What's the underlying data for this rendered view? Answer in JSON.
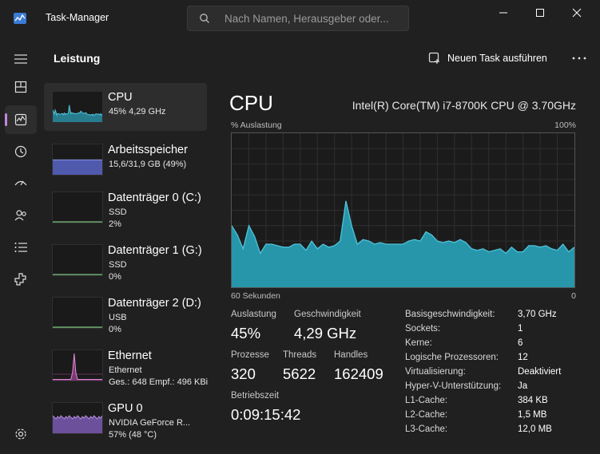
{
  "app": {
    "title": "Task-Manager"
  },
  "search": {
    "placeholder": "Nach Namen, Herausgeber oder..."
  },
  "header": {
    "title": "Leistung",
    "new_task_label": "Neuen Task ausführen"
  },
  "nav": [
    {
      "name": "menu-icon"
    },
    {
      "name": "processes-icon"
    },
    {
      "name": "performance-icon",
      "active": true
    },
    {
      "name": "history-icon"
    },
    {
      "name": "startup-icon"
    },
    {
      "name": "users-icon"
    },
    {
      "name": "details-icon"
    },
    {
      "name": "services-icon"
    },
    {
      "name": "settings-icon"
    }
  ],
  "perf_list": [
    {
      "key": "cpu",
      "name": "CPU",
      "line1": "45%  4,29 GHz",
      "line2": "",
      "line3": "",
      "color": "#4fc3d9",
      "fill": "#2a8ea3",
      "active": true
    },
    {
      "key": "mem",
      "name": "Arbeitsspeicher",
      "line1": "15,6/31,9 GB (49%)",
      "line2": "",
      "line3": "",
      "color": "#8c95e8",
      "fill": "#5a66c8"
    },
    {
      "key": "disk0",
      "name": "Datenträger 0 (C:)",
      "line1": "SSD",
      "line2": "2%",
      "line3": "",
      "color": "#8fd18f",
      "fill": "#3b6b3b"
    },
    {
      "key": "disk1",
      "name": "Datenträger 1 (G:)",
      "line1": "SSD",
      "line2": "0%",
      "line3": "",
      "color": "#8fd18f",
      "fill": "#3b6b3b"
    },
    {
      "key": "disk2",
      "name": "Datenträger 2 (D:)",
      "line1": "USB",
      "line2": "0%",
      "line3": "",
      "color": "#8fd18f",
      "fill": "#3b6b3b"
    },
    {
      "key": "eth",
      "name": "Ethernet",
      "line1": "Ethernet",
      "line2": "Ges.: 648 Empf.: 496 KBi",
      "line3": "",
      "color": "#e38ad7",
      "fill": "#8b3f83"
    },
    {
      "key": "gpu",
      "name": "GPU 0",
      "line1": "NVIDIA GeForce R...",
      "line2": "57%  (48 °C)",
      "line3": "",
      "color": "#b58fe0",
      "fill": "#7b5ab3"
    }
  ],
  "main": {
    "title": "CPU",
    "model": "Intel(R) Core(TM) i7-8700K CPU @ 3.70GHz",
    "axis_top_left": "% Auslastung",
    "axis_top_right": "100%",
    "axis_bottom_left": "60 Sekunden",
    "axis_bottom_right": "0",
    "graph_color": "#4fc3d9",
    "graph_fill": "#2796ab",
    "usage_history": [
      40,
      34,
      25,
      40,
      33,
      22,
      28,
      28,
      27,
      26,
      26,
      28,
      28,
      24,
      30,
      25,
      28,
      26,
      27,
      30,
      56,
      40,
      28,
      31,
      30,
      28,
      29,
      28,
      28,
      28,
      28,
      30,
      31,
      30,
      36,
      34,
      30,
      29,
      30,
      29,
      31,
      29,
      25,
      24,
      25,
      23,
      24,
      25,
      22,
      26,
      23,
      23,
      27,
      27,
      26,
      27,
      25,
      24,
      28,
      23,
      26
    ]
  },
  "stats": {
    "auslastung_label": "Auslastung",
    "auslastung": "45%",
    "geschw_label": "Geschwindigkeit",
    "geschw": "4,29 GHz",
    "prozesse_label": "Prozesse",
    "prozesse": "320",
    "threads_label": "Threads",
    "threads": "5622",
    "handles_label": "Handles",
    "handles": "162409",
    "betriebszeit_label": "Betriebszeit",
    "betriebszeit": "0:09:15:42"
  },
  "specs": [
    {
      "k": "Basisgeschwindigkeit:",
      "v": "3,70 GHz"
    },
    {
      "k": "Sockets:",
      "v": "1"
    },
    {
      "k": "Kerne:",
      "v": "6"
    },
    {
      "k": "Logische Prozessoren:",
      "v": "12"
    },
    {
      "k": "Virtualisierung:",
      "v": "Deaktiviert"
    },
    {
      "k": "Hyper-V-Unterstützung:",
      "v": "Ja"
    },
    {
      "k": "L1-Cache:",
      "v": "384 KB"
    },
    {
      "k": "L2-Cache:",
      "v": "1,5 MB"
    },
    {
      "k": "L3-Cache:",
      "v": "12,0 MB"
    }
  ]
}
